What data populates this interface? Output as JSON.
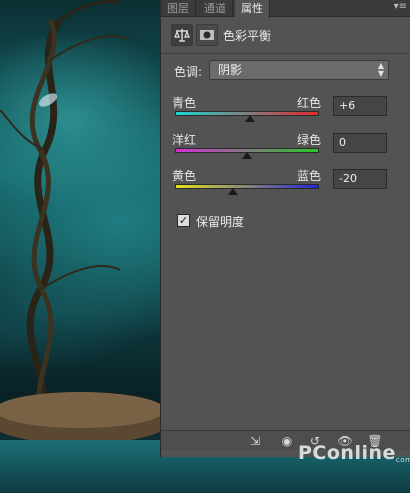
{
  "tabs": [
    {
      "label": "图层"
    },
    {
      "label": "通道"
    },
    {
      "label": "属性"
    }
  ],
  "panel": {
    "title": "色彩平衡",
    "tone_label": "色调:",
    "tone_value": "阴影",
    "sliders": [
      {
        "left": "青色",
        "right": "红色",
        "value": "+6",
        "fraction": 0.52
      },
      {
        "left": "洋红",
        "right": "绿色",
        "value": "0",
        "fraction": 0.5
      },
      {
        "left": "黄色",
        "right": "蓝色",
        "value": "-20",
        "fraction": 0.4
      }
    ],
    "preserve_luminosity": {
      "label": "保留明度",
      "checked": true
    }
  },
  "watermark": {
    "text": "PConline",
    "suffix": "com.cn"
  }
}
